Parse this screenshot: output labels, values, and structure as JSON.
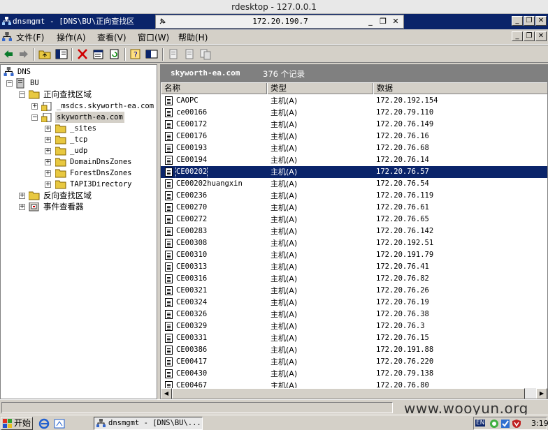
{
  "rdesktop": {
    "title": "rdesktop - 127.0.0.1",
    "host": "172.20.190.7"
  },
  "window": {
    "title": "dnsmgmt - [DNS\\BU\\正向查找区"
  },
  "menu": [
    "文件(F)",
    "操作(A)",
    "查看(V)",
    "窗口(W)",
    "帮助(H)"
  ],
  "tree": {
    "root": "DNS",
    "server": "BU",
    "forward_zones": "正向查找区域",
    "msdcs": "_msdcs.skyworth-ea.com",
    "zone": "skyworth-ea.com",
    "subfolders": [
      "_sites",
      "_tcp",
      "_udp",
      "DomainDnsZones",
      "ForestDnsZones",
      "TAPI3Directory"
    ],
    "reverse_zones": "反向查找区域",
    "event_viewer": "事件查看器"
  },
  "pane": {
    "zone_name": "skyworth-ea.com",
    "record_count": "376 个记录",
    "columns": [
      "名称",
      "类型",
      "数据"
    ]
  },
  "records": [
    {
      "name": "CAOPC",
      "type": "主机(A)",
      "data": "172.20.192.154"
    },
    {
      "name": "ce00166",
      "type": "主机(A)",
      "data": "172.20.79.110"
    },
    {
      "name": "CE00172",
      "type": "主机(A)",
      "data": "172.20.76.149"
    },
    {
      "name": "CE00176",
      "type": "主机(A)",
      "data": "172.20.76.16"
    },
    {
      "name": "CE00193",
      "type": "主机(A)",
      "data": "172.20.76.68"
    },
    {
      "name": "CE00194",
      "type": "主机(A)",
      "data": "172.20.76.14"
    },
    {
      "name": "CE00202",
      "type": "主机(A)",
      "data": "172.20.76.57",
      "selected": true
    },
    {
      "name": "CE00202huangxin",
      "type": "主机(A)",
      "data": "172.20.76.54"
    },
    {
      "name": "CE00236",
      "type": "主机(A)",
      "data": "172.20.76.119"
    },
    {
      "name": "CE00270",
      "type": "主机(A)",
      "data": "172.20.76.61"
    },
    {
      "name": "CE00272",
      "type": "主机(A)",
      "data": "172.20.76.65"
    },
    {
      "name": "CE00283",
      "type": "主机(A)",
      "data": "172.20.76.142"
    },
    {
      "name": "CE00308",
      "type": "主机(A)",
      "data": "172.20.192.51"
    },
    {
      "name": "CE00310",
      "type": "主机(A)",
      "data": "172.20.191.79"
    },
    {
      "name": "CE00313",
      "type": "主机(A)",
      "data": "172.20.76.41"
    },
    {
      "name": "CE00316",
      "type": "主机(A)",
      "data": "172.20.76.82"
    },
    {
      "name": "CE00321",
      "type": "主机(A)",
      "data": "172.20.76.26"
    },
    {
      "name": "CE00324",
      "type": "主机(A)",
      "data": "172.20.76.19"
    },
    {
      "name": "CE00326",
      "type": "主机(A)",
      "data": "172.20.76.38"
    },
    {
      "name": "CE00329",
      "type": "主机(A)",
      "data": "172.20.76.3"
    },
    {
      "name": "CE00331",
      "type": "主机(A)",
      "data": "172.20.76.15"
    },
    {
      "name": "CE00386",
      "type": "主机(A)",
      "data": "172.20.191.88"
    },
    {
      "name": "CE00417",
      "type": "主机(A)",
      "data": "172.20.76.220"
    },
    {
      "name": "CE00430",
      "type": "主机(A)",
      "data": "172.20.79.138"
    },
    {
      "name": "CE00467",
      "type": "主机(A)",
      "data": "172.20.76.80"
    }
  ],
  "watermark": "www.wooyun.org",
  "taskbar": {
    "start": "开始",
    "task": "dnsmgmt - [DNS\\BU\\...",
    "lang": "EN",
    "clock": "3:19"
  },
  "colors": {
    "selection": "#0a246a",
    "titlebar": "#0a246a",
    "header_bg": "#808080"
  }
}
